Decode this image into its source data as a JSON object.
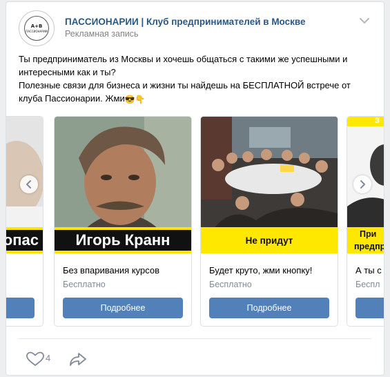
{
  "post": {
    "community_name": "ПАССИОНАРИИ | Клуб предпринимателей в Москве",
    "ad_label": "Рекламная запись",
    "avatar": {
      "top_text": "КЛУБ",
      "monogram": "А+В",
      "bottom_text": "ПАССИОНАРИИ",
      "ring_text": "ПРЕДПРИНИМАТЕЛЕЙ"
    },
    "text_lines": [
      "Ты предприниматель из Москвы и хочешь общаться с такими же успешными и",
      "интересными как и ты?",
      "Полезные связи для бизнеса и жизни ты найдешь на БЕСПЛАТНОЙ встрече от",
      "клуба Пассионарии. Жми"
    ],
    "emojis": [
      "😎",
      "👇"
    ],
    "menu_icon": "chevron-down-icon"
  },
  "cards": [
    {
      "banner_text": "стопас",
      "title": "",
      "price": "",
      "button": ""
    },
    {
      "banner_text": "Игорь Кранн",
      "title": "Без впаривания курсов",
      "price": "Бесплатно",
      "button": "Подробнее"
    },
    {
      "banner_text": "Не придут",
      "title": "Будет круто, жми кнопку!",
      "price": "Бесплатно",
      "button": "Подробнее"
    },
    {
      "banner_text": "При",
      "banner_text2": "предпр",
      "banner_top": "З",
      "title": "А ты с",
      "price": "Беспл",
      "button": ""
    }
  ],
  "footer": {
    "like_icon": "heart-icon",
    "like_count": "4",
    "share_icon": "share-arrow-icon"
  },
  "colors": {
    "link": "#2a5885",
    "button": "#5181b8",
    "banner_yellow": "#ffe800",
    "banner_black": "#111111"
  }
}
